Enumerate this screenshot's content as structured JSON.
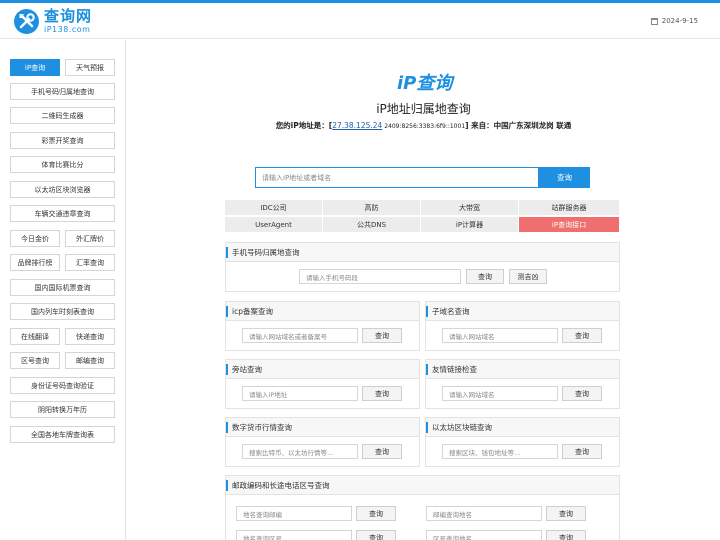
{
  "header": {
    "logo_title": "查询网",
    "logo_sub": "iP138.com",
    "date": "2024-9-15"
  },
  "sidebar": {
    "items": [
      "iP查询",
      "天气预报",
      "手机号码归属地查询",
      "二维码生成器",
      "彩票开奖查询",
      "体育比赛比分",
      "以太坊区块浏览器",
      "车辆交通违章查询",
      "今日金价",
      "外汇牌价",
      "品牌排行榜",
      "汇率查询",
      "国内国际机票查询",
      "国内列车时刻表查询",
      "在线翻译",
      "快递查询",
      "区号查询",
      "邮编查询",
      "身份证号码查询验证",
      "阴阳转换万年历",
      "全国各地车牌查询表"
    ]
  },
  "main": {
    "ip_logo": "iP查询",
    "title": "iP地址归属地查询",
    "ip_prefix": "您的iP地址是：[",
    "ip_address": "27.38.125.24",
    "ipv6": " 2409:8256:3383:6f9::1001",
    "ip_suffix": "] 来自：中国广东深圳龙岗 联通",
    "search_placeholder": "请输入iP地址或者域名",
    "search_button": "查询",
    "tabs": [
      "IDC公司",
      "高防",
      "大带宽",
      "站群服务器",
      "UserAgent",
      "公共DNS",
      "iP计算器",
      "iP查询接口"
    ]
  },
  "panels": {
    "mobile": {
      "title": "手机号码归属地查询",
      "placeholder": "请输入手机号码段",
      "button": "查询",
      "button2": "测吉凶"
    },
    "icp": {
      "title": "icp备案查询",
      "placeholder": "请输入网站域名或者备案号",
      "button": "查询"
    },
    "subdomain": {
      "title": "子域名查询",
      "placeholder": "请输入网站域名",
      "button": "查询"
    },
    "sidesite": {
      "title": "旁站查询",
      "placeholder": "请输入iP地址",
      "button": "查询"
    },
    "friendlink": {
      "title": "友情链接检查",
      "placeholder": "请输入网站域名",
      "button": "查询"
    },
    "crypto": {
      "title": "数字货币行情查询",
      "placeholder": "搜索比特币、以太坊行情等...",
      "button": "查询"
    },
    "eth": {
      "title": "以太坊区块链查询",
      "placeholder": "搜索区块、钱包地址等...",
      "button": "查询"
    },
    "postal": {
      "title": "邮政编码和长途电话区号查询",
      "ph1": "地名查询邮编",
      "ph2": "邮编查询地名",
      "ph3": "地名查询区号",
      "ph4": "区号查询地名",
      "button": "查询"
    }
  }
}
